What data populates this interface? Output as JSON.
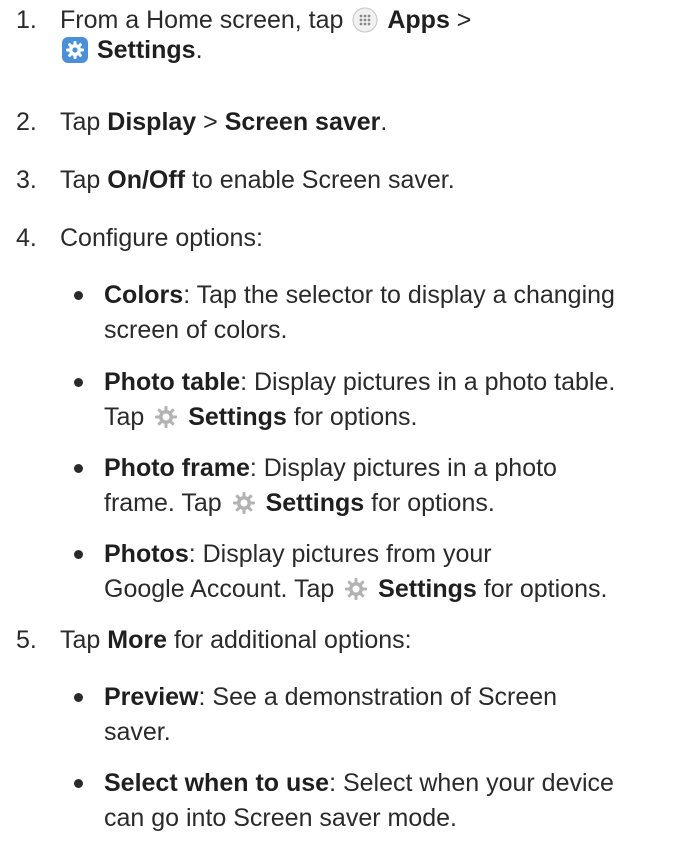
{
  "steps": [
    {
      "num": "1.",
      "pre": "From a Home screen, tap ",
      "apps_icon": "apps-grid-icon",
      "apps": "Apps",
      "sep": " >",
      "settings_icon": "settings-gear-blue-icon",
      "settings": "Settings",
      "end": "."
    },
    {
      "num": "2.",
      "pre": "Tap ",
      "b1": "Display",
      "mid": " > ",
      "b2": "Screen saver",
      "end": "."
    },
    {
      "num": "3.",
      "pre": "Tap ",
      "b1": "On/Off",
      "post": " to enable Screen saver."
    },
    {
      "num": "4.",
      "text": "Configure options:"
    },
    {
      "num": "5.",
      "pre": "Tap ",
      "b1": "More",
      "post": " for additional options:"
    }
  ],
  "options": [
    {
      "title": "Colors",
      "line1": ": Tap the selector to display a changing",
      "line2": "screen of colors."
    },
    {
      "title": "Photo table",
      "line1": ": Display pictures in a photo table.",
      "line2_pre": "Tap ",
      "icon": "settings-gear-icon",
      "settings": "Settings",
      "line2_post": " for options."
    },
    {
      "title": "Photo frame",
      "line1": ": Display pictures in a photo",
      "line2_pre": "frame. Tap ",
      "icon": "settings-gear-icon",
      "settings": "Settings",
      "line2_post": " for options."
    },
    {
      "title": "Photos",
      "line1": ": Display pictures from your",
      "line2_pre": "Google Account. Tap ",
      "icon": "settings-gear-icon",
      "settings": "Settings",
      "line2_post": " for options."
    }
  ],
  "more_options": [
    {
      "title": "Preview",
      "line1": ": See a demonstration of Screen",
      "line2": "saver."
    },
    {
      "title": "Select when to use",
      "line1": ": Select when your device",
      "line2": "can go into Screen saver mode."
    }
  ],
  "colors": {
    "text": "#2a2a2a",
    "gear_gray": "#b3b3b3",
    "settings_blue": "#4a90d9"
  }
}
